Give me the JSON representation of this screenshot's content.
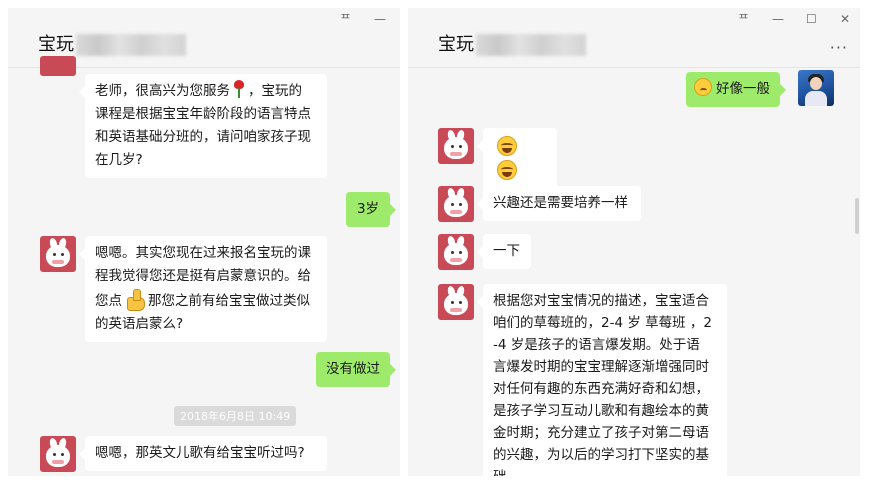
{
  "left_window": {
    "title": "宝玩",
    "messages": {
      "m1_line1": "老师，很高兴为您服务",
      "m1_line1b": "，宝玩的",
      "m1_line2": "课程是根据宝宝年龄阶段的语言特点",
      "m1_line3": "和英语基础分班的，请问咱家孩子现",
      "m1_line4": "在几岁?",
      "m2": "3岁",
      "m3_line1": "嗯嗯。其实您现在过来报名宝玩的课",
      "m3_line2": "程我觉得您还是挺有启蒙意识的。给",
      "m3_line3a": "您点",
      "m3_line3b": "那您之前有给宝宝做过类似",
      "m3_line4": "的英语启蒙么?",
      "m4": "没有做过",
      "timestamp": "2018年6月8日 10:49",
      "m5": "嗯嗯，那英文儿歌有给宝宝听过吗?"
    }
  },
  "right_window": {
    "title": "宝玩",
    "messages": {
      "u1": "好像一般",
      "m2": "兴趣还是需要培养一样",
      "m3": "一下",
      "m4_lines": [
        "根据您对宝宝情况的描述，宝宝适合",
        "咱们的草莓班的，2-4 岁 草莓班 ，2",
        "-4 岁是孩子的语言爆发期。处于语",
        "言爆发时期的宝宝理解逐渐增强同时",
        "对任何有趣的东西充满好奇和幻想，",
        "是孩子学习互动儿歌和有趣绘本的黄",
        "金时期；充分建立了孩子对第二母语",
        "的兴趣，为以后的学习打下坚实的基",
        "础。"
      ]
    }
  },
  "window_controls": {
    "pin": "ᄑ",
    "minimize": "—",
    "maximize": "☐",
    "close": "✕",
    "more": "···"
  },
  "icons": {
    "teacher_avatar": "bunny-avatar",
    "user_avatar": "person-avatar",
    "rose": "rose-emoji",
    "thumb": "thumbs-up-emoji",
    "cry": "cry-laugh-emoji",
    "sweat": "sweat-emoji"
  },
  "colors": {
    "self_bubble": "#9eea6a",
    "other_bubble": "#ffffff",
    "chat_bg": "#f5f5f5",
    "avatar_red": "#c94a57"
  }
}
